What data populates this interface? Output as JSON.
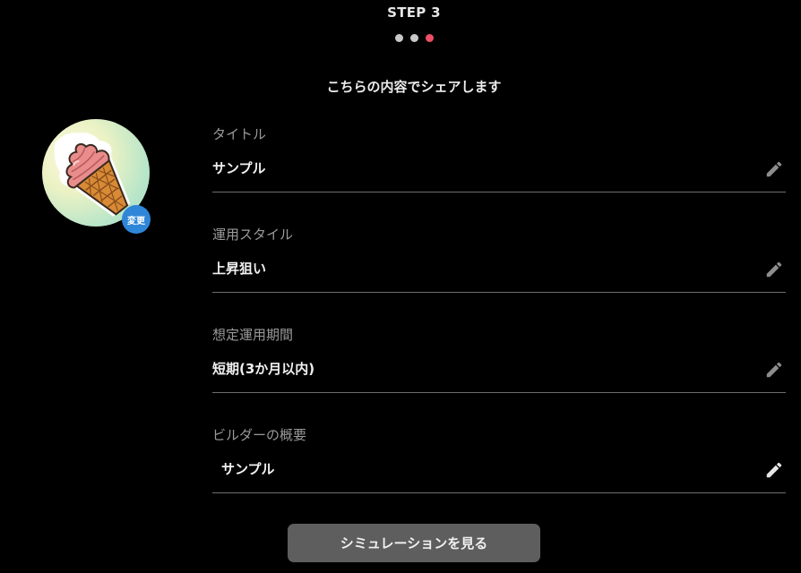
{
  "step": {
    "label": "STEP 3",
    "total": 3,
    "current": 3,
    "dot_color_inactive": "#c8c8c8",
    "dot_color_active": "#ef4f66"
  },
  "heading": "こちらの内容でシェアします",
  "avatar": {
    "image": "soft-serve-ice-cream-icon",
    "change_label": "変更",
    "badge_color": "#2f86d8"
  },
  "fields": [
    {
      "label": "タイトル",
      "value": "サンプル",
      "icon": "pencil-icon"
    },
    {
      "label": "運用スタイル",
      "value": "上昇狙い",
      "icon": "pencil-icon"
    },
    {
      "label": "想定運用期間",
      "value": "短期(3か月以内)",
      "icon": "pencil-icon"
    },
    {
      "label": "ビルダーの概要",
      "value": "サンプル",
      "icon": "pencil-icon"
    }
  ],
  "submit_button": {
    "label": "シミュレーションを見る",
    "color": "#5e5e5e"
  }
}
